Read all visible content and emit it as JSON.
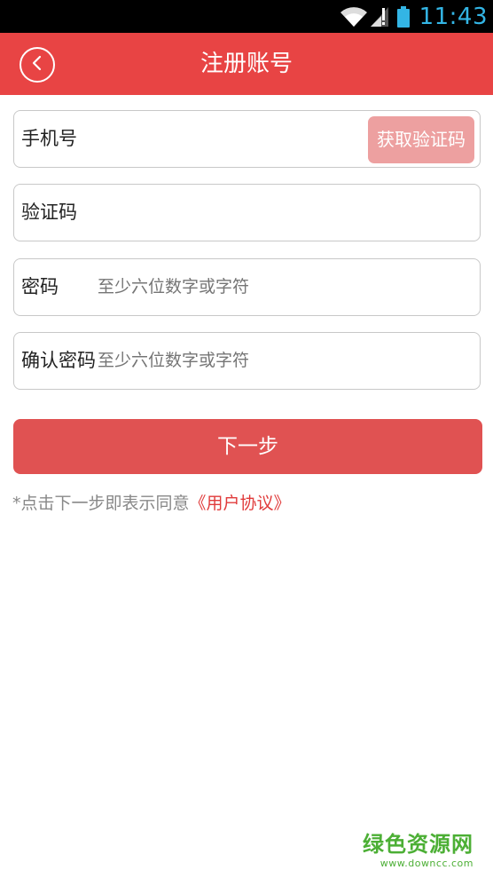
{
  "status_bar": {
    "time": "11:43",
    "icons": [
      "wifi-icon",
      "signal-icon",
      "battery-icon"
    ],
    "clock_color": "#33b5e5"
  },
  "nav": {
    "title": "注册账号",
    "back_icon": "back-chevron-icon",
    "background": "#e84444"
  },
  "form": {
    "phone": {
      "label": "手机号",
      "value": "",
      "get_code_label": "获取验证码"
    },
    "code": {
      "label": "验证码",
      "value": ""
    },
    "password": {
      "label": "密码",
      "placeholder": "至少六位数字或字符"
    },
    "confirm_password": {
      "label": "确认密码",
      "placeholder": "至少六位数字或字符"
    },
    "next_label": "下一步",
    "agreement_prefix": "*点击下一步即表示同意",
    "agreement_link": "《用户协议》"
  },
  "watermark": {
    "main": "绿色资源网",
    "sub": "www.downcc.com"
  },
  "colors": {
    "accent": "#e84444",
    "button": "#e05252",
    "button_disabled": "#eda0a0",
    "link": "#e03a3a"
  }
}
